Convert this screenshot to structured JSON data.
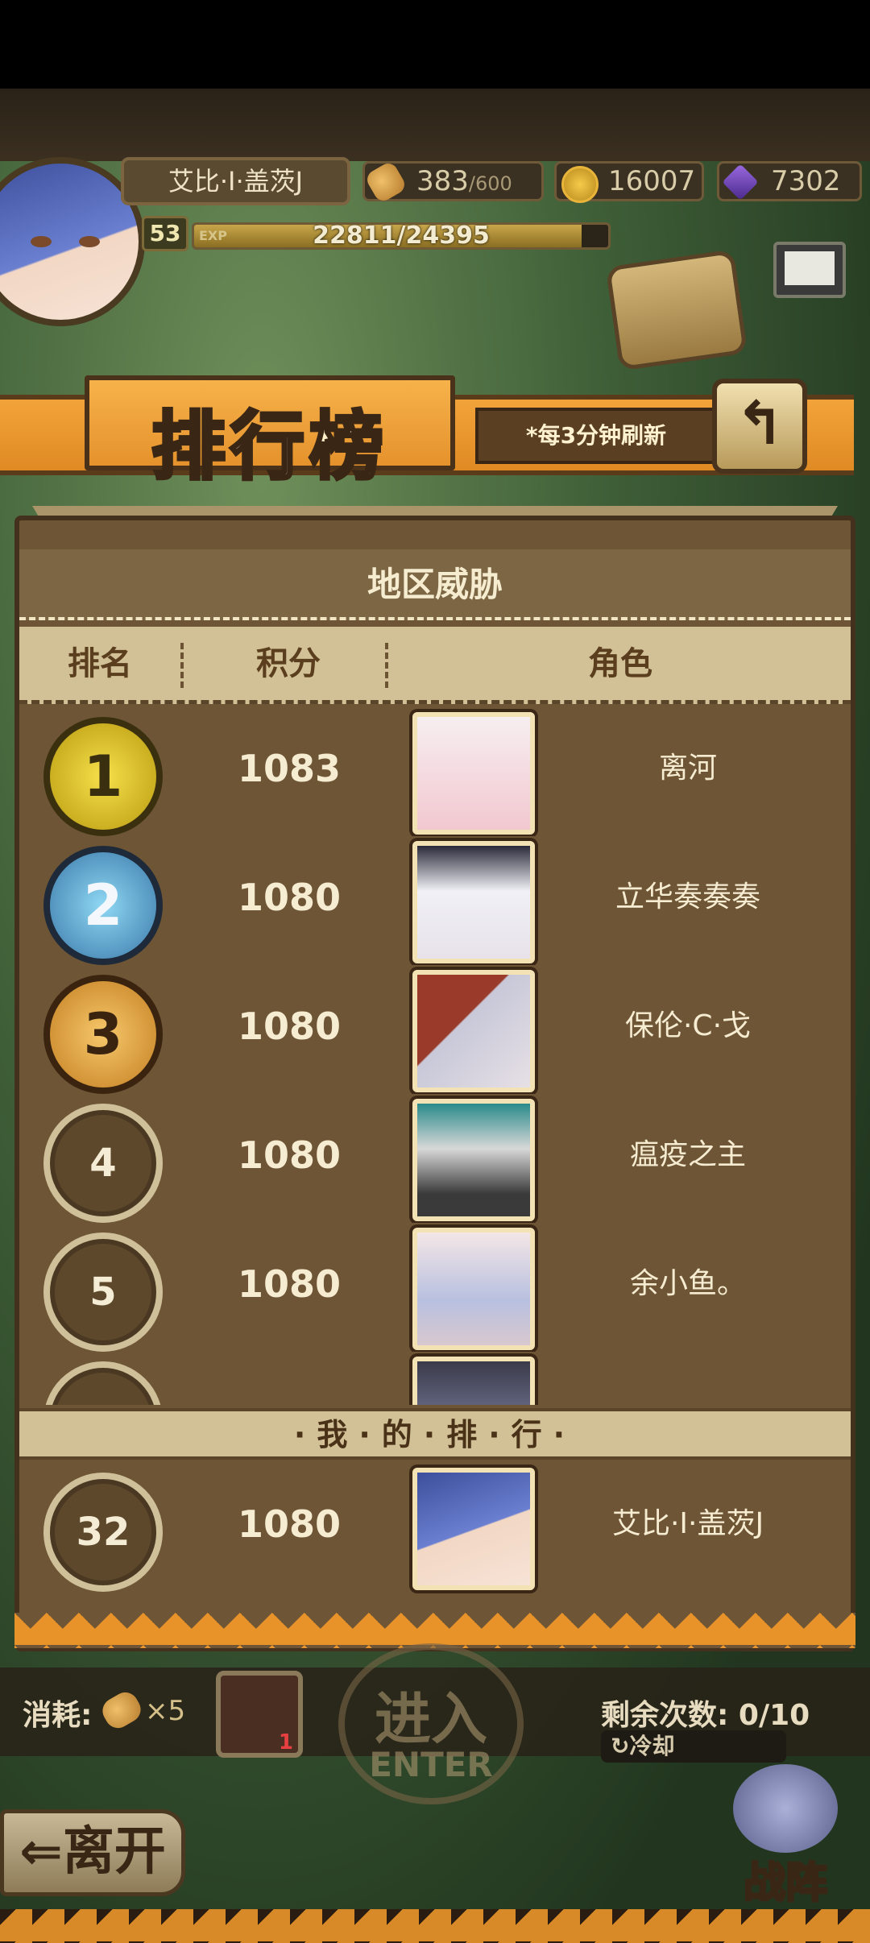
{
  "player": {
    "name": "艾比·I·盖茨J",
    "level": "53",
    "exp_label": "EXP",
    "exp_text": "22811/24395",
    "exp_progress": 0.935
  },
  "resources": {
    "stamina": {
      "value": "383",
      "max": "/600"
    },
    "gold": "16007",
    "gems": "7302"
  },
  "banner": {
    "title": "排行榜",
    "refresh_note": "*每3分钟刷新",
    "back_symbol": "↰"
  },
  "leaderboard": {
    "category": "地区威胁",
    "columns": {
      "rank": "排名",
      "score": "积分",
      "character": "角色"
    },
    "rows": [
      {
        "rank": "1",
        "score": "1083",
        "name": "离河"
      },
      {
        "rank": "2",
        "score": "1080",
        "name": "立华奏奏奏"
      },
      {
        "rank": "3",
        "score": "1080",
        "name": "保伦·C·戈"
      },
      {
        "rank": "4",
        "score": "1080",
        "name": "瘟疫之主"
      },
      {
        "rank": "5",
        "score": "1080",
        "name": "余小鱼。"
      }
    ],
    "my_rank_label": "·我·的·排·行·",
    "my_rank": {
      "rank": "32",
      "score": "1080",
      "name": "艾比·I·盖茨J"
    }
  },
  "bottom": {
    "cost_label": "消耗:",
    "cost_value": "×5",
    "item_count": "1",
    "enter_cn": "进入",
    "enter_en": "ENTER",
    "remaining": "剩余次数: 0/10",
    "cooldown": "↻冷却",
    "leave": "⇐离开",
    "formation": "战阵"
  },
  "colors": {
    "accent_orange": "#e8922a",
    "panel_brown": "#6e5535",
    "header_tan": "#d2c196"
  }
}
